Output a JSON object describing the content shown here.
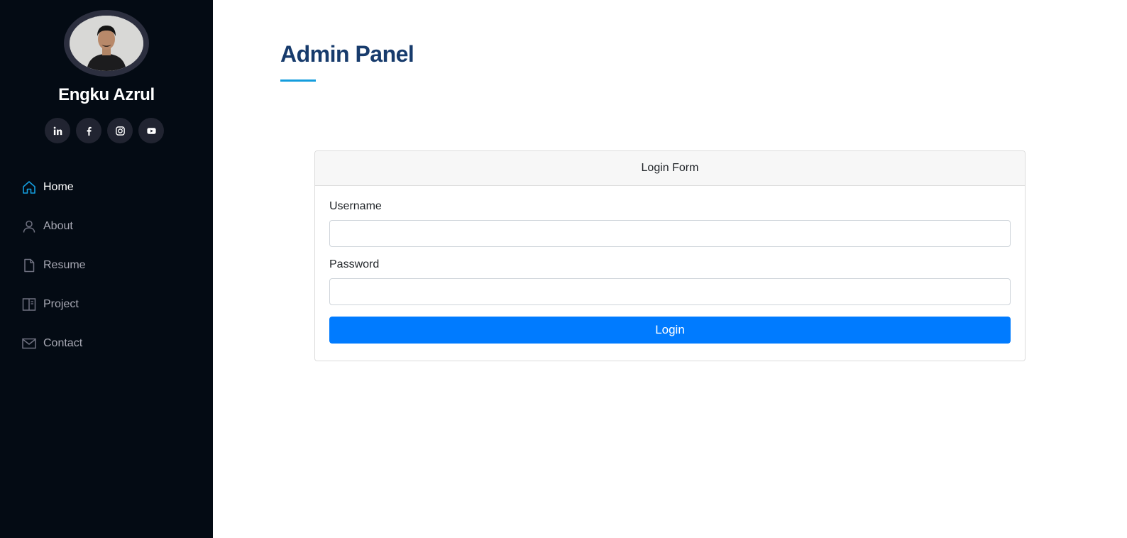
{
  "profile": {
    "name": "Engku Azrul",
    "avatar_icon": "profile-photo"
  },
  "social": [
    {
      "icon": "linkedin-icon"
    },
    {
      "icon": "facebook-icon"
    },
    {
      "icon": "instagram-icon"
    },
    {
      "icon": "youtube-icon"
    }
  ],
  "nav": {
    "items": [
      {
        "label": "Home",
        "icon": "home-icon",
        "active": true
      },
      {
        "label": "About",
        "icon": "person-icon",
        "active": false
      },
      {
        "label": "Resume",
        "icon": "file-icon",
        "active": false
      },
      {
        "label": "Project",
        "icon": "book-icon",
        "active": false
      },
      {
        "label": "Contact",
        "icon": "envelope-icon",
        "active": false
      }
    ]
  },
  "main": {
    "title": "Admin Panel"
  },
  "login_form": {
    "header": "Login Form",
    "username_label": "Username",
    "username_value": "",
    "password_label": "Password",
    "password_value": "",
    "submit_label": "Login"
  },
  "colors": {
    "sidebar_bg": "#040b14",
    "accent": "#149ddd",
    "title": "#173b6c",
    "button": "#007bff"
  }
}
